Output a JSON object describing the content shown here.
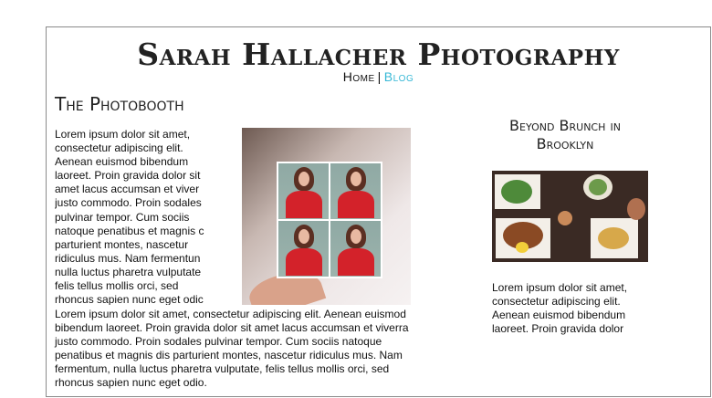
{
  "site": {
    "title": "Sarah Hallacher Photography",
    "nav": {
      "home": "Home",
      "separator": "|",
      "blog": "Blog"
    },
    "colors": {
      "link": "#38b8d6",
      "border": "#8a8a8a",
      "text": "#111111"
    }
  },
  "main_post": {
    "heading": "The Photobooth",
    "image_alt": "photobooth-strip-photo",
    "wrapped_lines": [
      "Lorem ipsum dolor sit amet,",
      "consectetur adipiscing elit.",
      "Aenean euismod bibendum",
      "laoreet. Proin gravida dolor sit",
      "amet lacus accumsan et viver",
      "justo commodo. Proin sodales",
      "pulvinar tempor. Cum sociis",
      "natoque penatibus et magnis c",
      "parturient montes, nascetur",
      "ridiculus mus. Nam fermentun",
      "nulla luctus pharetra vulputate",
      "felis tellus mollis orci, sed",
      "rhoncus sapien nunc eget odic"
    ],
    "full_lines": [
      "Lorem ipsum dolor sit amet, consectetur adipiscing elit. Aenean euismod",
      "bibendum laoreet. Proin gravida dolor sit amet lacus accumsan et viverra",
      "justo commodo. Proin sodales pulvinar tempor. Cum sociis natoque",
      "penatibus et magnis dis parturient montes, nascetur ridiculus mus. Nam",
      "fermentum, nulla luctus pharetra vulputate, felis tellus mollis orci, sed",
      "rhoncus sapien nunc eget odio."
    ]
  },
  "side_post": {
    "heading_lines": [
      "Beyond Brunch in",
      "Brooklyn"
    ],
    "image_alt": "brunch-table-photo",
    "lines": [
      "Lorem ipsum dolor sit amet,",
      "consectetur adipiscing elit.",
      "Aenean euismod bibendum",
      "laoreet. Proin gravida dolor"
    ]
  }
}
